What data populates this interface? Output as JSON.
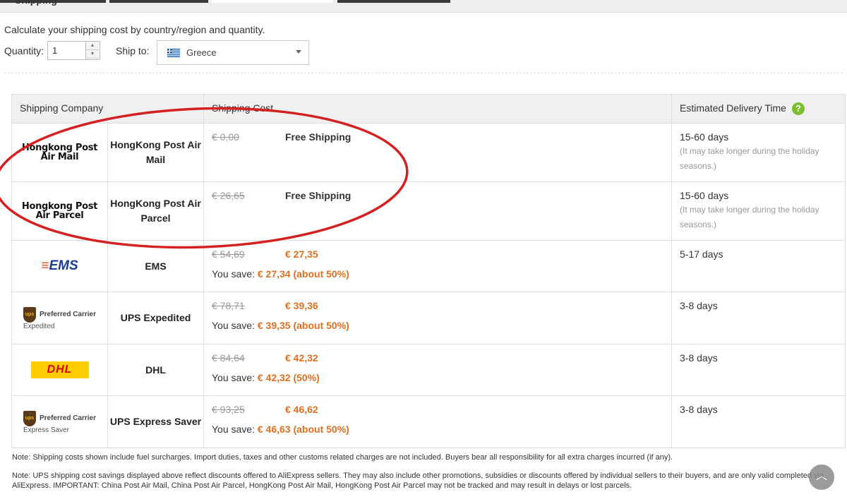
{
  "section_title": "Shipping",
  "intro": "Calculate your shipping cost by country/region and quantity.",
  "quantity": {
    "label": "Quantity:",
    "value": "1"
  },
  "ship_to": {
    "label": "Ship to:",
    "country": "Greece",
    "flag_icon": "greece-flag-icon"
  },
  "table": {
    "headers": {
      "company": "Shipping Company",
      "cost": "Shipping Cost",
      "time": "Estimated Delivery Time"
    },
    "rows": [
      {
        "logo_text": "Hongkong Post Air Mail",
        "name": "HongKong Post Air Mail",
        "original": "€ 0,00",
        "price": "Free Shipping",
        "free": true,
        "time": "15-60 days",
        "time_note": "(It may take longer during the holiday seasons.)"
      },
      {
        "logo_text": "Hongkong Post Air Parcel",
        "name": "HongKong Post Air Parcel",
        "original": "€ 26,65",
        "price": "Free Shipping",
        "free": true,
        "time": "15-60 days",
        "time_note": "(It may take longer during the holiday seasons.)"
      },
      {
        "logo_text": "EMS",
        "name": "EMS",
        "original": "€ 54,69",
        "price": "€ 27,35",
        "save_label": "You save:",
        "save": "€ 27,34 (about 50%)",
        "time": "5-17 days"
      },
      {
        "logo_text": "Preferred Carrier",
        "logo_sub": "Expedited",
        "name": "UPS Expedited",
        "original": "€ 78,71",
        "price": "€ 39,36",
        "save_label": "You save:",
        "save": "€ 39,35 (about 50%)",
        "time": "3-8 days"
      },
      {
        "logo_text": "DHL",
        "name": "DHL",
        "original": "€ 84,64",
        "price": "€ 42,32",
        "save_label": "You save:",
        "save": "€ 42,32 (50%)",
        "time": "3-8 days"
      },
      {
        "logo_text": "Preferred Carrier",
        "logo_sub": "Express Saver",
        "name": "UPS Express Saver",
        "original": "€ 93,25",
        "price": "€ 46,62",
        "save_label": "You save:",
        "save": "€ 46,63 (about 50%)",
        "time": "3-8 days"
      }
    ]
  },
  "notes": [
    "Note: Shipping costs shown include fuel surcharges. Import duties, taxes and other customs related charges are not included. Buyers bear all responsibility for all extra charges incurred (if any).",
    "Note: UPS shipping cost savings displayed above reflect discounts offered to AliExpress sellers. They may also include other promotions, subsidies or discounts offered by individual sellers to their buyers, and are only valid completed via AliExpress. IMPORTANT: China Post Air Mail, China Post Air Parcel, HongKong Post Air Mail, HongKong Post Air Parcel may not be tracked and may result in delays or lost parcels."
  ],
  "colors": {
    "price": "#e07020",
    "annotation": "#d42020",
    "help": "#7bbf2f"
  }
}
